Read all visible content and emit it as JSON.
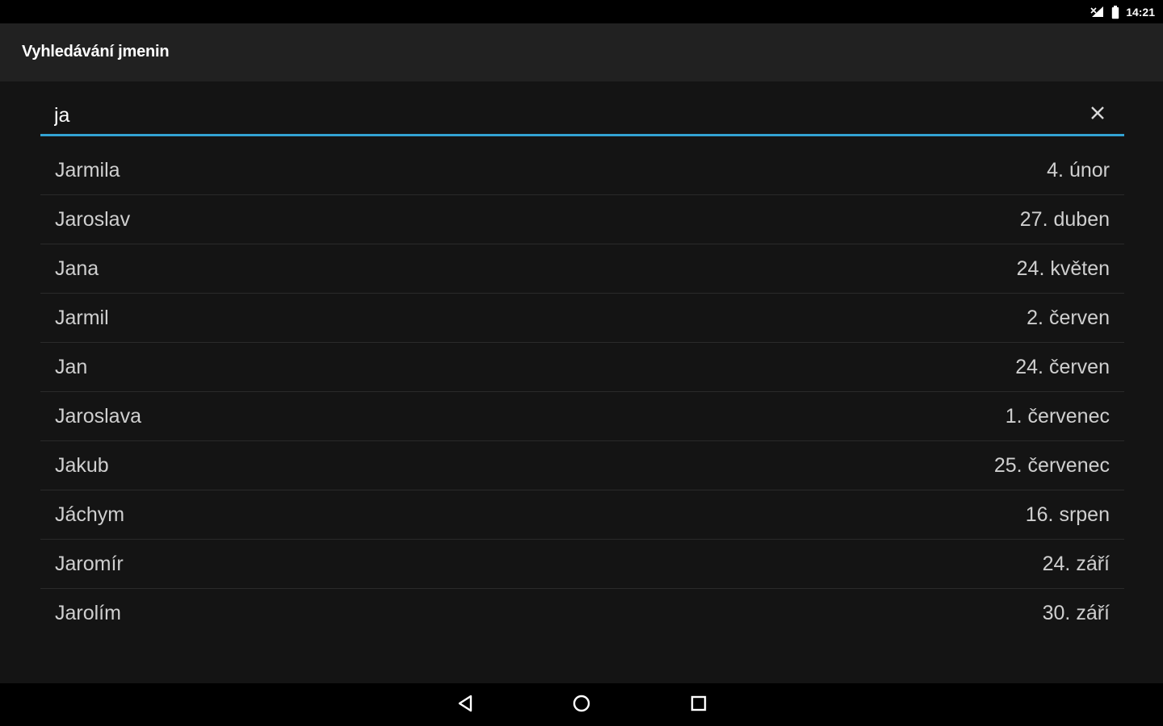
{
  "status_bar": {
    "time": "14:21",
    "icons": [
      "signal-icon",
      "battery-icon"
    ]
  },
  "app_bar": {
    "title": "Vyhledávání jmenin"
  },
  "search": {
    "value": "ja",
    "clear_icon": "close-icon",
    "underline_color": "#33a3d4"
  },
  "results": [
    {
      "name": "Jarmila",
      "date": "4. únor"
    },
    {
      "name": "Jaroslav",
      "date": "27. duben"
    },
    {
      "name": "Jana",
      "date": "24. květen"
    },
    {
      "name": "Jarmil",
      "date": "2. červen"
    },
    {
      "name": "Jan",
      "date": "24. červen"
    },
    {
      "name": "Jaroslava",
      "date": "1. červenec"
    },
    {
      "name": "Jakub",
      "date": "25. červenec"
    },
    {
      "name": "Jáchym",
      "date": "16. srpen"
    },
    {
      "name": "Jaromír",
      "date": "24. září"
    },
    {
      "name": "Jarolím",
      "date": "30. září"
    }
  ],
  "nav_bar": {
    "buttons": [
      "back-icon",
      "home-icon",
      "recents-icon"
    ]
  }
}
